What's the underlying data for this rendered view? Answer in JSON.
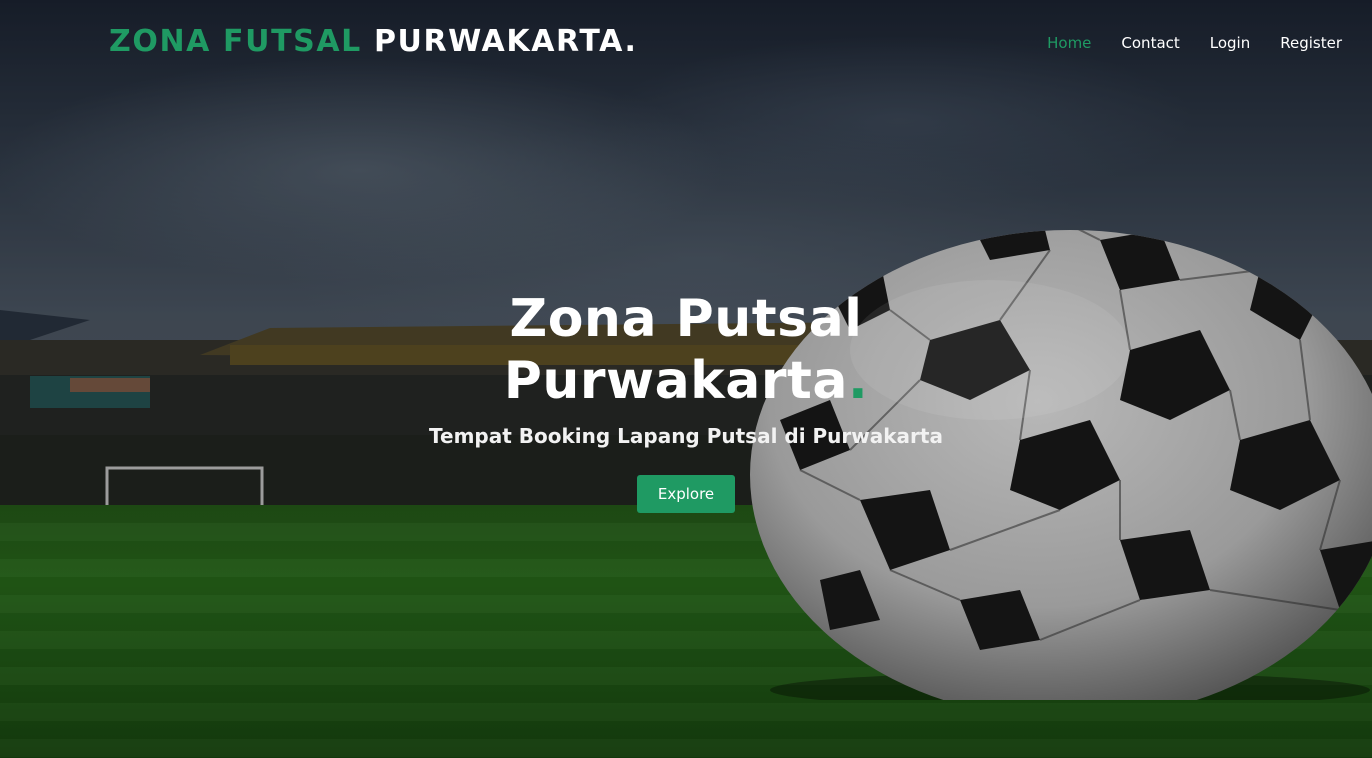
{
  "brand": {
    "part1": "ZONA FUTSAL",
    "part2": "PURWAKARTA.",
    "accent_color": "#1f9a63"
  },
  "nav": {
    "home": "Home",
    "contact": "Contact",
    "login": "Login",
    "register": "Register",
    "active": "home"
  },
  "hero": {
    "title_line1": "Zona Putsal",
    "title_line2": "Purwakarta",
    "title_dot": ".",
    "subtitle": "Tempat Booking Lapang Putsal di Purwakarta",
    "button_label": "Explore"
  },
  "background": {
    "scene": "stadium with soccer ball on grass",
    "icon": "soccer-ball-icon"
  }
}
